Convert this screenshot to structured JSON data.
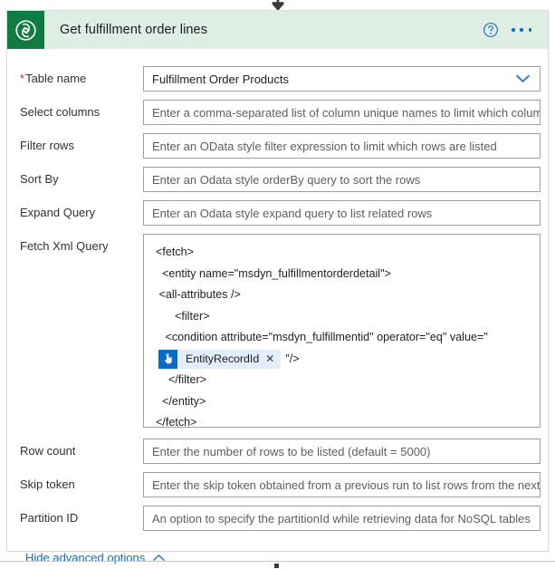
{
  "connector": {
    "top_arrow_icon": "arrow-down-icon",
    "bottom_dot_icon": "connector-dot-icon"
  },
  "header": {
    "app_icon": "dataverse-icon",
    "title": "Get fulfillment order lines",
    "help_icon": "help-circle-icon",
    "more_icon": "ellipsis-icon",
    "brand_color": "#107c41",
    "background_color": "#dfeee4",
    "accent_color": "#0f6cbd"
  },
  "fields": {
    "table_name": {
      "label": "Table name",
      "required_marker": "*",
      "value": "Fulfillment Order Products",
      "chevron_icon": "chevron-down-icon"
    },
    "select_columns": {
      "label": "Select columns",
      "placeholder": "Enter a comma-separated list of column unique names to limit which columns are returned"
    },
    "filter_rows": {
      "label": "Filter rows",
      "placeholder": "Enter an OData style filter expression to limit which rows are listed"
    },
    "sort_by": {
      "label": "Sort By",
      "placeholder": "Enter an Odata style orderBy query to sort the rows"
    },
    "expand_query": {
      "label": "Expand Query",
      "placeholder": "Enter an Odata style expand query to list related rows"
    },
    "fetch_xml_query": {
      "label": "Fetch Xml Query",
      "lines": [
        "  <fetch>",
        "    <entity name=\"msdyn_fulfillmentorderdetail\">",
        "   <all-attributes />",
        "        <filter>",
        "     <condition attribute=\"msdyn_fulfillmentid\" operator=\"eq\" value=\""
      ],
      "token": {
        "icon": "manual-trigger-hand-icon",
        "label": "EntityRecordId",
        "close_icon": "close-x-icon",
        "trailing_text": "\"/>",
        "icon_color": "#0b6bcb",
        "chip_color": "#e3eefb"
      },
      "closing_lines": [
        "      </filter>",
        "    </entity>",
        "  </fetch>"
      ]
    },
    "row_count": {
      "label": "Row count",
      "placeholder": "Enter the number of rows to be listed (default = 5000)"
    },
    "skip_token": {
      "label": "Skip token",
      "placeholder": "Enter the skip token obtained from a previous run to list rows from the next page"
    },
    "partition_id": {
      "label": "Partition ID",
      "placeholder": "An option to specify the partitionId while retrieving data for NoSQL tables"
    }
  },
  "footer": {
    "advanced_options_label": "Hide advanced options",
    "chevron_icon": "chevron-up-icon"
  }
}
